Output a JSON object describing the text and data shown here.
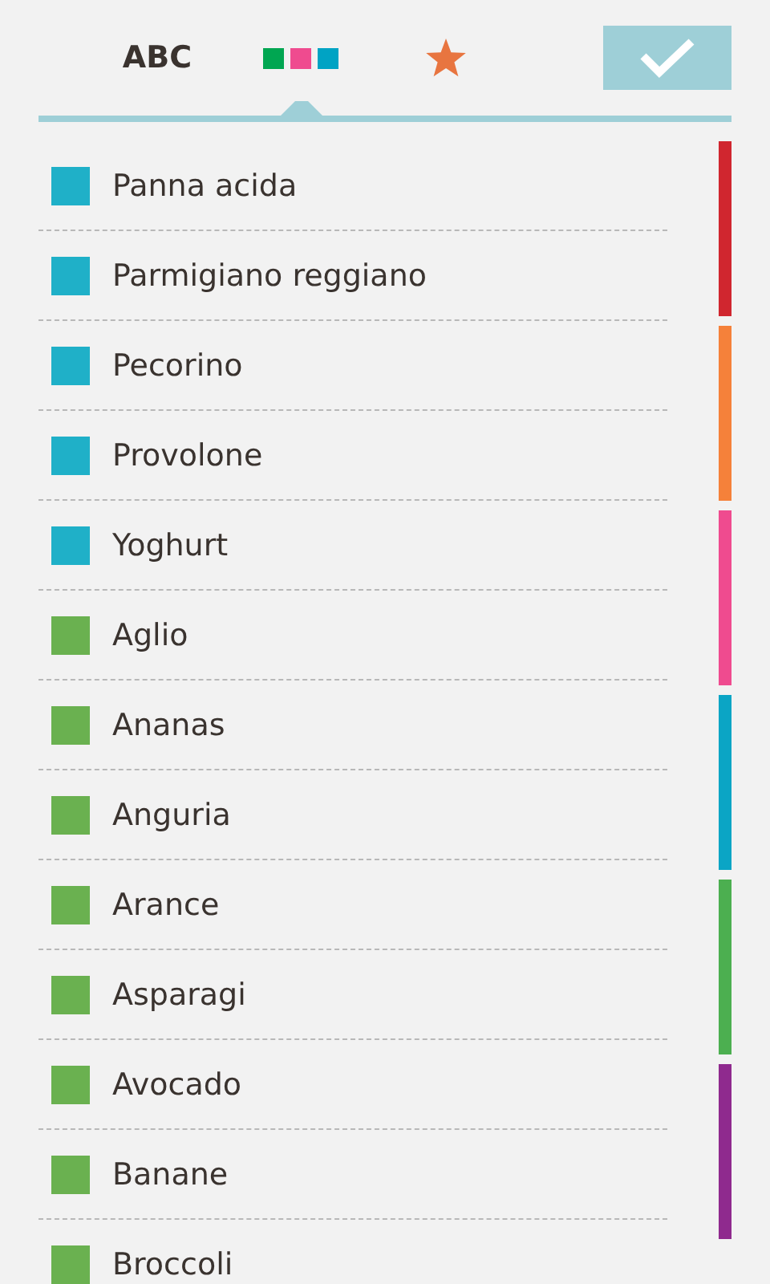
{
  "tabs": [
    {
      "kind": "text",
      "label": "ABC",
      "selected": false
    },
    {
      "kind": "colors",
      "selected": true
    },
    {
      "kind": "star",
      "selected": false
    }
  ],
  "items": [
    {
      "label": "Panna acida",
      "color": "#1fb0c8"
    },
    {
      "label": "Parmigiano reggiano",
      "color": "#1fb0c8"
    },
    {
      "label": "Pecorino",
      "color": "#1fb0c8"
    },
    {
      "label": "Provolone",
      "color": "#1fb0c8"
    },
    {
      "label": "Yoghurt",
      "color": "#1fb0c8"
    },
    {
      "label": "Aglio",
      "color": "#6ab150"
    },
    {
      "label": "Ananas",
      "color": "#6ab150"
    },
    {
      "label": "Anguria",
      "color": "#6ab150"
    },
    {
      "label": "Arance",
      "color": "#6ab150"
    },
    {
      "label": "Asparagi",
      "color": "#6ab150"
    },
    {
      "label": "Avocado",
      "color": "#6ab150"
    },
    {
      "label": "Banane",
      "color": "#6ab150"
    },
    {
      "label": "Broccoli",
      "color": "#6ab150"
    }
  ],
  "category_index": [
    {
      "color": "#d0262f"
    },
    {
      "color": "#f5813a"
    },
    {
      "color": "#ef4b8f"
    },
    {
      "color": "#0ba5c5"
    },
    {
      "color": "#4caf50"
    },
    {
      "color": "#8f2a8e"
    }
  ]
}
